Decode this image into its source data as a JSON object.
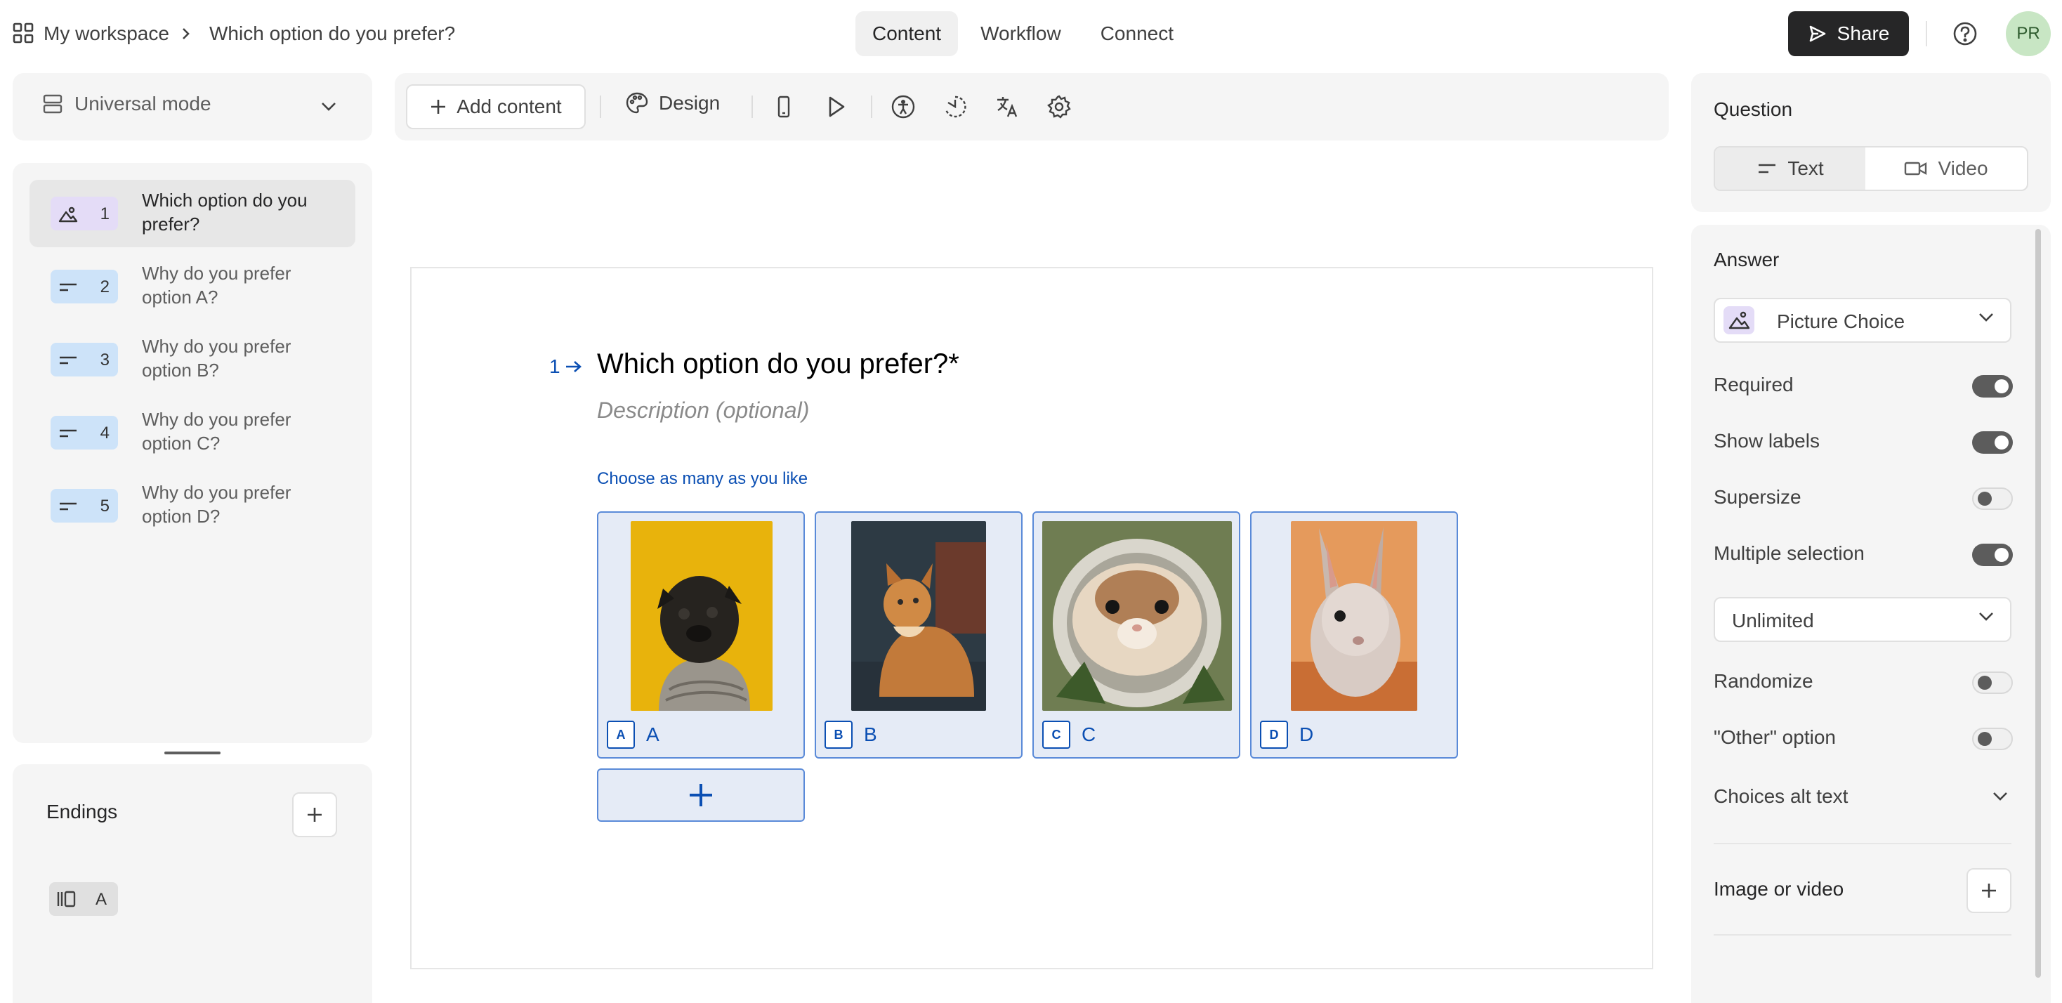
{
  "header": {
    "workspace": "My workspace",
    "form_title": "Which option do you prefer?",
    "tabs": [
      {
        "label": "Content",
        "active": true
      },
      {
        "label": "Workflow",
        "active": false
      },
      {
        "label": "Connect",
        "active": false
      }
    ],
    "share_label": "Share",
    "avatar_initials": "PR"
  },
  "sidebar": {
    "mode_label": "Universal mode",
    "questions": [
      {
        "num": "1",
        "text": "Which option do you prefer?",
        "icon": "picture-choice-icon",
        "badge_color": "#e4dcf7"
      },
      {
        "num": "2",
        "text": "Why do you prefer option A?",
        "icon": "short-text-icon",
        "badge_color": "#cde3f9"
      },
      {
        "num": "3",
        "text": "Why do you prefer option B?",
        "icon": "short-text-icon",
        "badge_color": "#cde3f9"
      },
      {
        "num": "4",
        "text": "Why do you prefer option C?",
        "icon": "short-text-icon",
        "badge_color": "#cde3f9"
      },
      {
        "num": "5",
        "text": "Why do you prefer option D?",
        "icon": "short-text-icon",
        "badge_color": "#cde3f9"
      }
    ],
    "endings_title": "Endings",
    "endings": [
      {
        "label": "A",
        "icon": "ending-icon"
      }
    ]
  },
  "toolbar": {
    "add_content_label": "Add content",
    "design_label": "Design"
  },
  "canvas": {
    "question_number": "1",
    "question_title": "Which option do you prefer?*",
    "description_placeholder": "Description (optional)",
    "hint": "Choose as many as you like",
    "choices": [
      {
        "key": "A",
        "label": "A",
        "image": "pug-photo"
      },
      {
        "key": "B",
        "label": "B",
        "image": "cat-photo"
      },
      {
        "key": "C",
        "label": "C",
        "image": "hamster-photo"
      },
      {
        "key": "D",
        "label": "D",
        "image": "rabbit-photo"
      }
    ],
    "accent_color": "#0b4fb3"
  },
  "right_panel": {
    "question_label": "Question",
    "question_types": [
      "Text",
      "Video"
    ],
    "answer_label": "Answer",
    "answer_type": "Picture Choice",
    "settings": [
      {
        "label": "Required",
        "on": true
      },
      {
        "label": "Show labels",
        "on": true
      },
      {
        "label": "Supersize",
        "on": false
      },
      {
        "label": "Multiple selection",
        "on": true
      }
    ],
    "selection_limit": "Unlimited",
    "settings_2": [
      {
        "label": "Randomize",
        "on": false
      },
      {
        "label": "\"Other\" option",
        "on": false
      }
    ],
    "alt_text_label": "Choices alt text",
    "media_label": "Image or video"
  }
}
